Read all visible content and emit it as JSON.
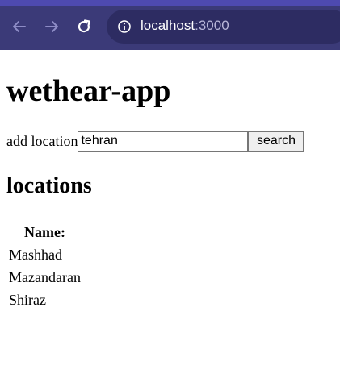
{
  "browser": {
    "url_host": "localhost",
    "url_port": ":3000",
    "toolbar_color": "#3b3a78",
    "back_icon": "arrow-left-icon",
    "forward_icon": "arrow-right-icon",
    "reload_icon": "reload-icon",
    "info_icon": "info-icon"
  },
  "page": {
    "title": "wethear-app",
    "add_location_label": "add location",
    "search_input_value": "tehran",
    "search_button_label": "search",
    "locations_heading": "locations",
    "table": {
      "header": "Name:",
      "rows": [
        "Mashhad",
        "Mazandaran",
        "Shiraz"
      ]
    }
  }
}
